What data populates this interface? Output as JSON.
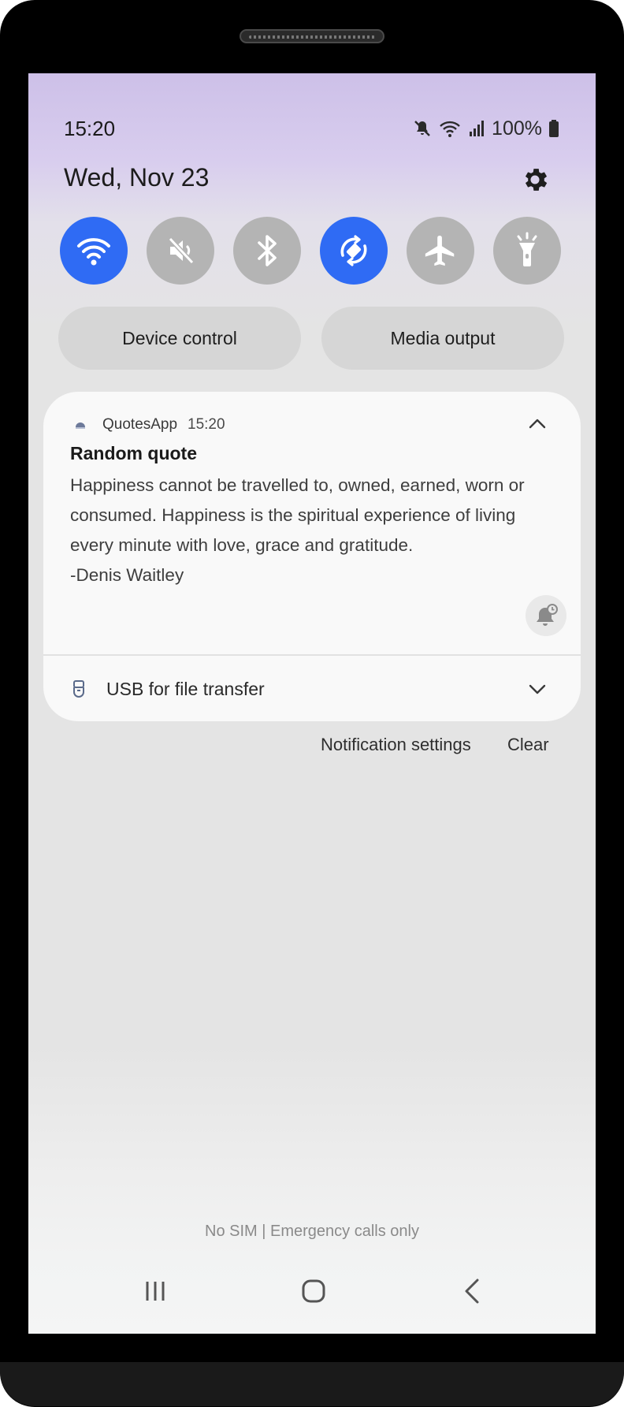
{
  "status_bar": {
    "time": "15:20",
    "battery_percent": "100%",
    "icons": [
      "mute-icon",
      "wifi-icon",
      "signal-icon",
      "battery-icon"
    ]
  },
  "header": {
    "date": "Wed, Nov 23",
    "settings_icon": "gear-icon"
  },
  "quick_settings": {
    "tiles": [
      {
        "name": "wifi",
        "icon": "wifi-icon",
        "on": true
      },
      {
        "name": "sound",
        "icon": "mute-icon",
        "on": false
      },
      {
        "name": "bluetooth",
        "icon": "bluetooth-icon",
        "on": false
      },
      {
        "name": "auto-rotate",
        "icon": "auto-rotate-icon",
        "on": true
      },
      {
        "name": "airplane-mode",
        "icon": "airplane-icon",
        "on": false
      },
      {
        "name": "flashlight",
        "icon": "flashlight-icon",
        "on": false
      }
    ],
    "device_control_label": "Device control",
    "media_output_label": "Media output"
  },
  "notification": {
    "app_name": "QuotesApp",
    "time": "15:20",
    "title": "Random quote",
    "body": "Happiness cannot be travelled to, owned, earned, worn or\nconsumed. Happiness is the spiritual experience of living\nevery minute with love, grace and gratitude.\n-Denis Waitley"
  },
  "usb_notification": {
    "label": "USB for file transfer"
  },
  "actions": {
    "notification_settings_label": "Notification settings",
    "clear_label": "Clear"
  },
  "footer": {
    "carrier_text": "No SIM | Emergency calls only"
  },
  "colors": {
    "accent": "#2f6bf4",
    "tile_off": "#b4b4b4"
  }
}
